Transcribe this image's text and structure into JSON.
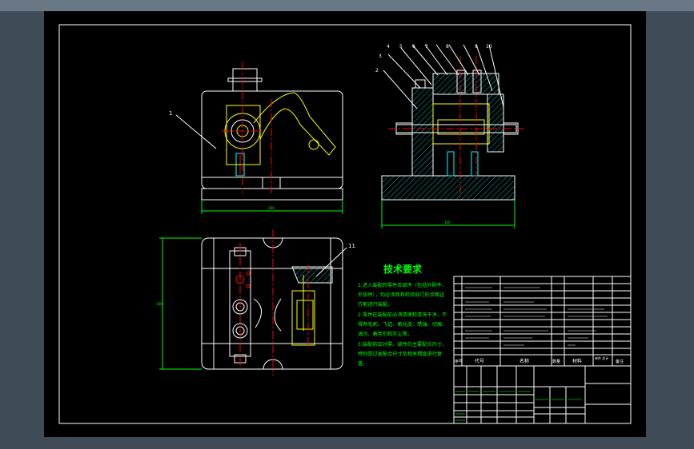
{
  "drawing": {
    "tech_title": "技术要求",
    "tech_lines": [
      "1.进入装配的零件及部件（包括外购件、",
      "外协件），均必须具有检验部门的合格证",
      "方能进行装配。",
      "2.零件在装配前必须清理和清洗干净，不",
      "得有毛刺、飞边、氧化皮、锈蚀、切屑、",
      "油污、着色剂和灰尘等。",
      "3.装配前应对零、部件的主要配合尺寸，",
      "特别是过盈配合尺寸及相关精度进行复",
      "查。"
    ],
    "callouts": {
      "c1": "1",
      "c2": "2",
      "c3": "3",
      "c4": "4",
      "c5": "5",
      "c6": "6",
      "c7": "7",
      "c8": "8",
      "c9": "9",
      "c10": "10",
      "c11": "11"
    },
    "title_block": {
      "col_no": "序号",
      "col_code": "代号",
      "col_name": "名称",
      "col_qty": "数量",
      "col_material": "材料",
      "col_weight": "单件 总计",
      "col_remark": "备注"
    }
  },
  "colors": {
    "frame": "#ffffff",
    "outline": "#ffffff",
    "yellow": "#ffff00",
    "green": "#00ff00",
    "red": "#ff0000",
    "cyan": "#00ffff",
    "magenta": "#ff00ff"
  }
}
